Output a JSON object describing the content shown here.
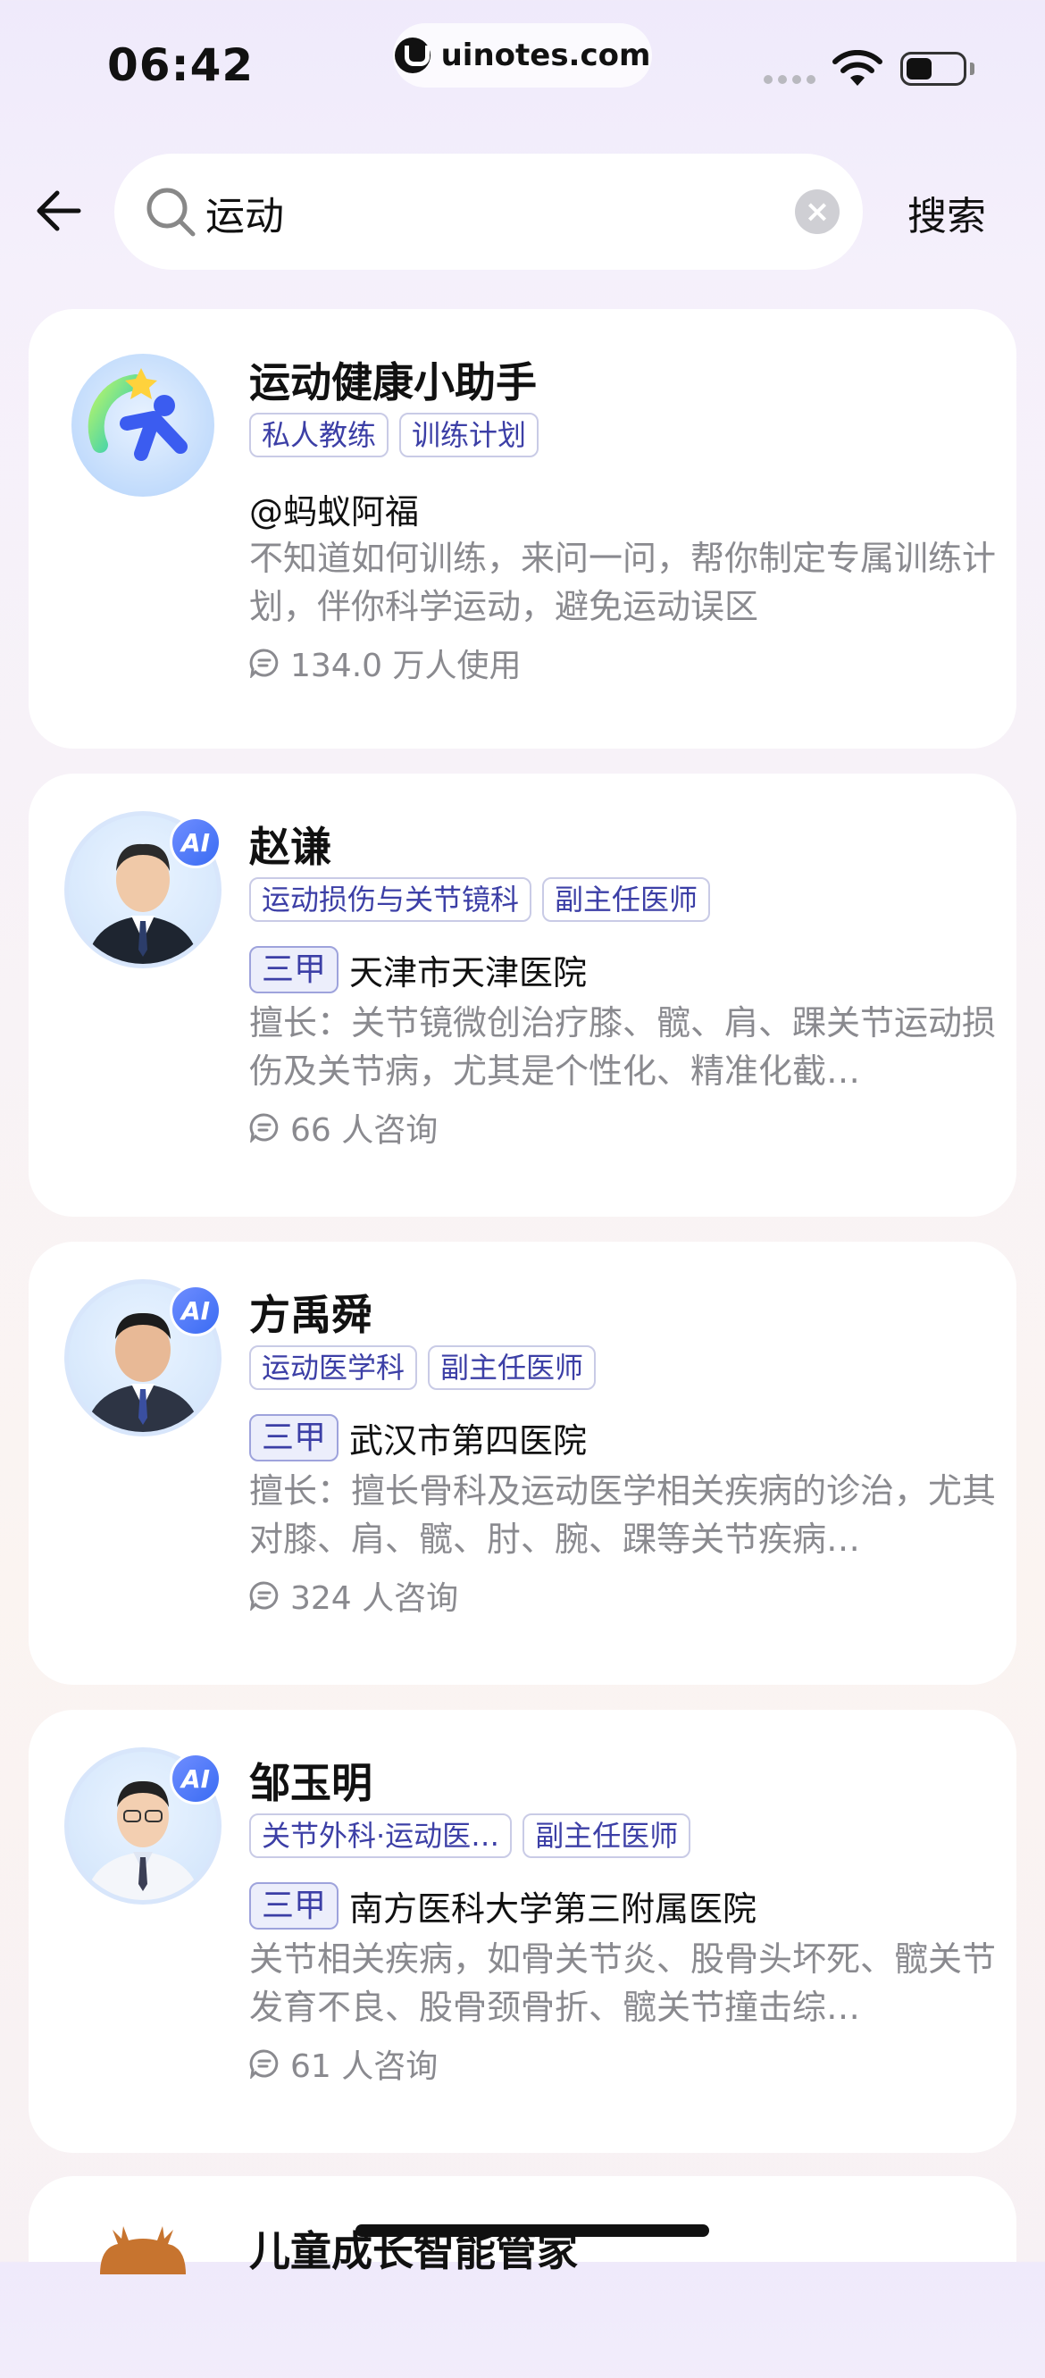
{
  "status_bar": {
    "time": "06:42",
    "url": "uinotes.com"
  },
  "search": {
    "value": "运动",
    "placeholder": "搜索",
    "submit_label": "搜索"
  },
  "results": [
    {
      "type": "assistant",
      "name": "运动健康小助手",
      "tags": [
        "私人教练",
        "训练计划"
      ],
      "author": "@蚂蚁阿福",
      "description": "不知道如何训练，来问一问，帮你制定专属训练计划，伴你科学运动，避免运动误区",
      "usage": "134.0 万人使用"
    },
    {
      "type": "doctor",
      "ai_badge": "AI",
      "name": "赵谦",
      "tags": [
        "运动损伤与关节镜科",
        "副主任医师"
      ],
      "grade": "三甲",
      "hospital": "天津市天津医院",
      "description": "擅长：关节镜微创治疗膝、髋、肩、踝关节运动损伤及关节病，尤其是个性化、精准化截…",
      "usage": "66 人咨询"
    },
    {
      "type": "doctor",
      "ai_badge": "AI",
      "name": "方禹舜",
      "tags": [
        "运动医学科",
        "副主任医师"
      ],
      "grade": "三甲",
      "hospital": "武汉市第四医院",
      "description": "擅长：擅长骨科及运动医学相关疾病的诊治，尤其对膝、肩、髋、肘、腕、踝等关节疾病…",
      "usage": "324 人咨询"
    },
    {
      "type": "doctor",
      "ai_badge": "AI",
      "name": "邹玉明",
      "tags": [
        "关节外科·运动医…",
        "副主任医师"
      ],
      "grade": "三甲",
      "hospital": "南方医科大学第三附属医院",
      "description": "关节相关疾病，如骨关节炎、股骨头坏死、髋关节发育不良、股骨颈骨折、髋关节撞击综…",
      "usage": "61 人咨询"
    },
    {
      "type": "assistant",
      "name": "儿童成长智能管家"
    }
  ]
}
